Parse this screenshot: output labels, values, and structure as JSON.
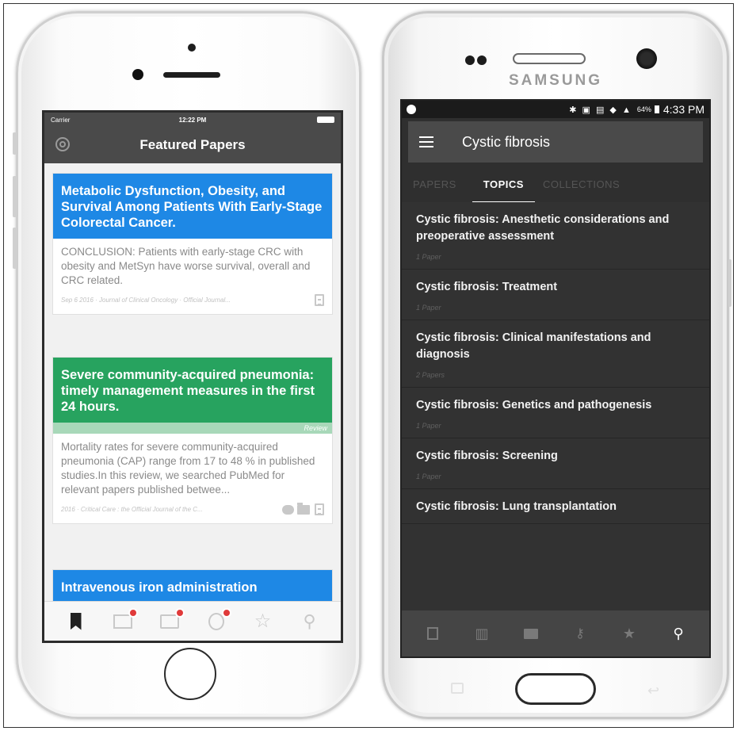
{
  "ios": {
    "status": {
      "carrier": "Carrier",
      "time": "12:22 PM"
    },
    "nav_title": "Featured Papers",
    "cards": [
      {
        "title": "Metabolic Dysfunction, Obesity, and Survival Among Patients With Early-Stage Colorectal Cancer.",
        "color": "#1e88e5",
        "excerpt": "CONCLUSION: Patients with early-stage CRC with obesity and MetSyn have worse survival, overall and CRC related.",
        "meta": "Sep 6 2016 · Journal of Clinical Oncology · Official Journal..."
      },
      {
        "title": "Severe community-acquired pneumonia: timely management measures in the first 24 hours.",
        "color": "#27a35f",
        "tag": "Review",
        "excerpt": "Mortality rates for severe community-acquired pneumonia (CAP) range from 17 to 48 % in published studies.In this review, we searched PubMed for relevant papers published betwee...",
        "meta": "2016 · Critical Care : the Official Journal of the C..."
      },
      {
        "title": "Intravenous iron administration",
        "color": "#1e88e5"
      }
    ],
    "tabbar": [
      "bookmark-icon",
      "news-icon",
      "folder-icon",
      "lightbulb-icon",
      "star-icon",
      "search-icon"
    ]
  },
  "android": {
    "brand": "SAMSUNG",
    "status": {
      "battery_pct": "64%",
      "time": "4:33 PM"
    },
    "toolbar_title": "Cystic fibrosis",
    "tabs": [
      "PAPERS",
      "TOPICS",
      "COLLECTIONS"
    ],
    "active_tab": "TOPICS",
    "topics": [
      {
        "title": "Cystic fibrosis: Anesthetic considerations and preoperative assessment",
        "count": "1 Paper"
      },
      {
        "title": "Cystic fibrosis: Treatment",
        "count": "1 Paper"
      },
      {
        "title": "Cystic fibrosis: Clinical manifestations and diagnosis",
        "count": "2 Papers"
      },
      {
        "title": "Cystic fibrosis: Genetics and pathogenesis",
        "count": "1 Paper"
      },
      {
        "title": "Cystic fibrosis: Screening",
        "count": "1 Paper"
      },
      {
        "title": "Cystic fibrosis: Lung transplantation",
        "count": ""
      }
    ],
    "bottom_nav": [
      "bookmark-icon",
      "library-icon",
      "folder-icon",
      "key-icon",
      "star-icon",
      "search-icon"
    ]
  }
}
